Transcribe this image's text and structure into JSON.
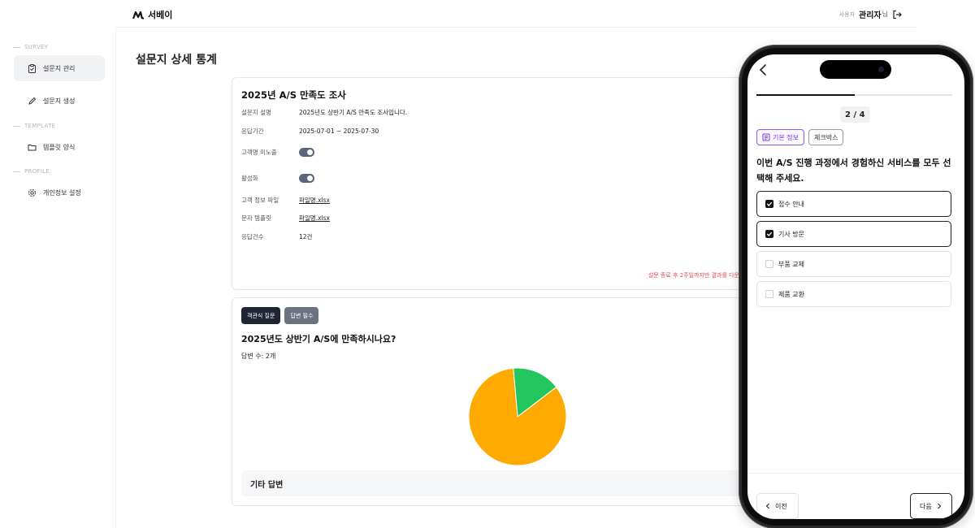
{
  "app": {
    "logo_text": "서베이",
    "user_role": "사용자",
    "user_name": "관리자",
    "user_suffix": "님"
  },
  "sidebar": {
    "sections": [
      {
        "label": "SURVEY"
      },
      {
        "label": "TEMPLATE"
      },
      {
        "label": "PROFILE"
      }
    ],
    "items": [
      {
        "label": "설문지 관리",
        "icon": "clipboard-icon",
        "active": true
      },
      {
        "label": "설문지 생성",
        "icon": "pencil-icon",
        "active": false
      },
      {
        "label": "템플릿 양식",
        "icon": "folder-icon",
        "active": false
      },
      {
        "label": "개인정보 설정",
        "icon": "gear-icon",
        "active": false
      }
    ]
  },
  "page": {
    "title": "설문지 상세 통계"
  },
  "survey": {
    "title": "2025년 A/S 만족도 조사",
    "rows": [
      {
        "label": "설문지 설명",
        "value": "2025년도 상반기 A/S 만족도 조사입니다."
      },
      {
        "label": "응답기간",
        "value": "2025-07-01 ~ 2025-07-30"
      },
      {
        "label": "고객명 미노출",
        "toggle": true
      },
      {
        "label": "활성화",
        "toggle": true
      },
      {
        "label": "고객 정보 파일",
        "value": "파일명.xlsx"
      },
      {
        "label": "문자 템플릿",
        "value": "파일명.xlsx"
      },
      {
        "label": "응답건수",
        "value": "12건"
      }
    ],
    "warning": "설문 종료 후 2주일까지만 결과를 다운"
  },
  "question_card": {
    "badge_type": "객관식 질문",
    "badge_required": "답변 필수",
    "title": "2025년도 상반기 A/S에 만족하시나요?",
    "answer_count": "답변 수: 2개",
    "other_title": "기타 답변"
  },
  "chart_data": {
    "type": "pie",
    "values": [
      84,
      16
    ],
    "colors": [
      "#FFAA00",
      "#22C55E"
    ]
  },
  "phone": {
    "progress": 0.5,
    "step": "2 / 4",
    "tag_basic": "기본 정보",
    "tag_type": "체크박스",
    "question": "이번 A/S 진행 과정에서 경험하신 서비스를 모두 선택해 주세요.",
    "options": [
      {
        "label": "접수 안내",
        "checked": true
      },
      {
        "label": "기사 방문",
        "checked": true
      },
      {
        "label": "부품 교체",
        "checked": false
      },
      {
        "label": "제품 교환",
        "checked": false
      }
    ],
    "prev_label": "이전",
    "next_label": "다음"
  },
  "colors": {
    "accent_dark": "#1f2533",
    "toggle_on": "#5b6577",
    "warning": "#e5484d",
    "tag_purple": "#8b5cf6"
  }
}
